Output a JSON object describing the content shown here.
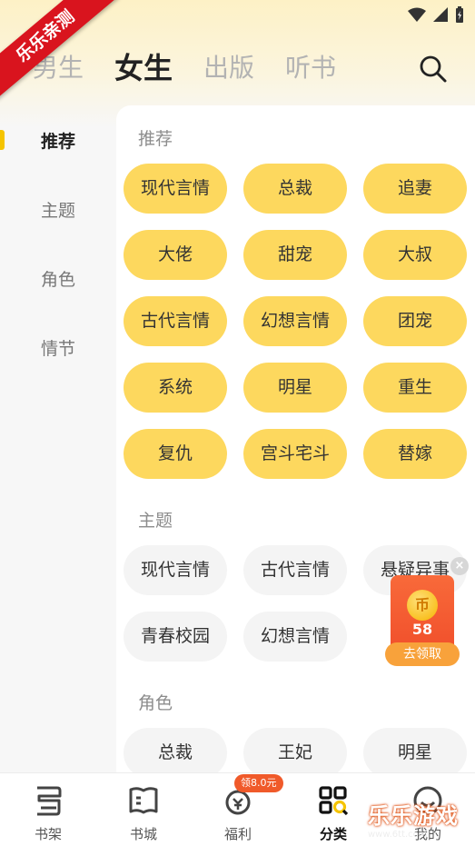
{
  "ribbon": "乐乐亲测",
  "top_tabs": [
    {
      "label": "男生",
      "active": false
    },
    {
      "label": "女生",
      "active": true
    },
    {
      "label": "出版",
      "active": false
    },
    {
      "label": "听书",
      "active": false
    }
  ],
  "sidebar": {
    "items": [
      {
        "label": "推荐",
        "active": true
      },
      {
        "label": "主题",
        "active": false
      },
      {
        "label": "角色",
        "active": false
      },
      {
        "label": "情节",
        "active": false
      }
    ]
  },
  "sections": {
    "recommend": {
      "title": "推荐",
      "chips": [
        "现代言情",
        "总裁",
        "追妻",
        "大佬",
        "甜宠",
        "大叔",
        "古代言情",
        "幻想言情",
        "团宠",
        "系统",
        "明星",
        "重生",
        "复仇",
        "宫斗宅斗",
        "替嫁"
      ]
    },
    "theme": {
      "title": "主题",
      "chips": [
        "现代言情",
        "古代言情",
        "悬疑异事",
        "青春校园",
        "幻想言情"
      ]
    },
    "role": {
      "title": "角色",
      "chips": [
        "总裁",
        "王妃",
        "明星"
      ]
    }
  },
  "floating_reward": {
    "coin_icon": "币",
    "count": "58",
    "button": "去领取",
    "close": "×"
  },
  "bottom_nav": [
    {
      "label": "书架",
      "icon": "bookshelf-icon",
      "active": false
    },
    {
      "label": "书城",
      "icon": "bookstore-icon",
      "active": false
    },
    {
      "label": "福利",
      "icon": "welfare-icon",
      "active": false
    },
    {
      "label": "分类",
      "icon": "category-icon",
      "active": true
    },
    {
      "label": "我的",
      "icon": "profile-icon",
      "active": false
    }
  ],
  "welfare_badge": "领8.0元",
  "watermark": {
    "text": "乐乐游戏",
    "url": "www.6tt.com"
  },
  "colors": {
    "accent": "#fdd85e",
    "chip_gray": "#f4f4f4",
    "ribbon": "#d9141e",
    "reward": "#f05a2a"
  }
}
